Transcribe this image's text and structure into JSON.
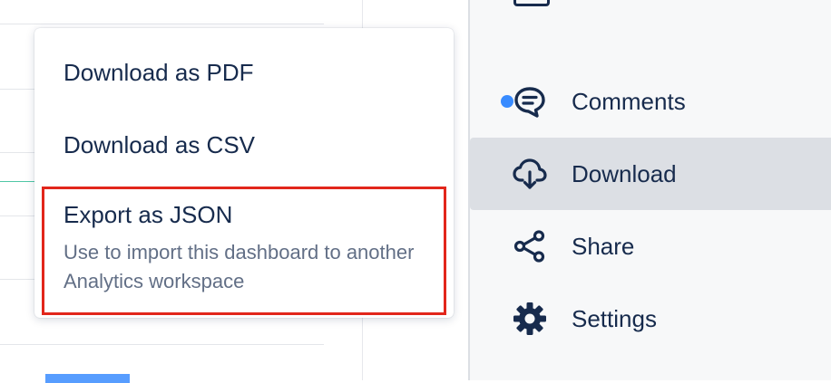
{
  "menu": {
    "items": [
      {
        "label": "Download as PDF"
      },
      {
        "label": "Download as CSV"
      },
      {
        "label": "Export as JSON",
        "description": "Use to import this dashboard to another Analytics workspace"
      }
    ]
  },
  "sidebar": {
    "items": [
      {
        "label": "Comments",
        "icon": "comment-icon",
        "unread": true
      },
      {
        "label": "Download",
        "icon": "cloud-download-icon",
        "active": true
      },
      {
        "label": "Share",
        "icon": "share-icon"
      },
      {
        "label": "Settings",
        "icon": "gear-icon"
      }
    ]
  },
  "colors": {
    "text": "#172b4d",
    "subtext": "#626f86",
    "highlight_border": "#e2261b",
    "unread_dot": "#388bff",
    "active_bg": "#dcdfe4",
    "sidebar_bg": "#f7f8f9"
  }
}
